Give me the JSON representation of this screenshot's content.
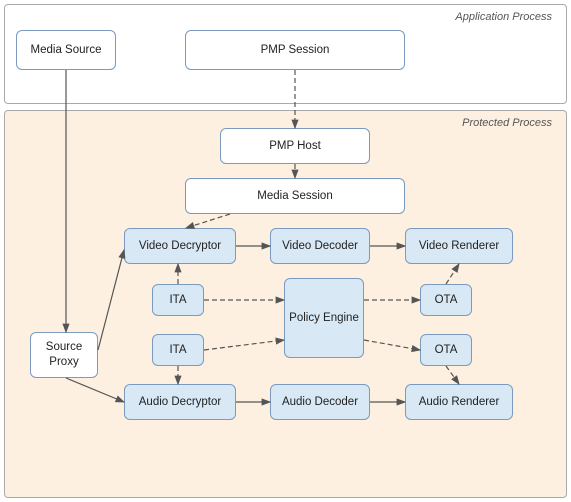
{
  "regions": {
    "app_process_label": "Application Process",
    "protected_process_label": "Protected Process"
  },
  "boxes": {
    "media_source": "Media Source",
    "pmp_session": "PMP Session",
    "pmp_host": "PMP Host",
    "media_session": "Media Session",
    "video_decryptor": "Video Decryptor",
    "video_decoder": "Video Decoder",
    "video_renderer": "Video Renderer",
    "ita_top": "ITA",
    "ota_top": "OTA",
    "policy_engine": "Policy\nEngine",
    "ita_bottom": "ITA",
    "ota_bottom": "OTA",
    "audio_decryptor": "Audio Decryptor",
    "audio_decoder": "Audio Decoder",
    "audio_renderer": "Audio Renderer",
    "source_proxy": "Source\nProxy"
  }
}
